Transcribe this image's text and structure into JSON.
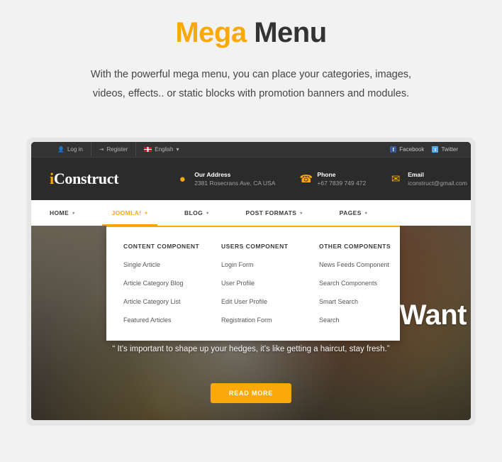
{
  "intro": {
    "title_accent": "Mega",
    "title_rest": " Menu",
    "subtitle_line1": "With the powerful mega menu, you can place your categories, images,",
    "subtitle_line2": "videos, effects.. or static blocks with promotion banners and modules."
  },
  "colors": {
    "accent": "#fba80a",
    "header_dark": "#2b2b2b",
    "topbar_dark": "#333333",
    "title_dark": "#333333"
  },
  "topbar": {
    "login": "Log in",
    "login_icon": "user-icon",
    "register": "Register",
    "register_icon": "sign-in-icon",
    "language": "English",
    "language_icon": "uk-flag-icon",
    "language_caret": "▾",
    "facebook": "Facebook",
    "facebook_icon": "facebook-icon",
    "facebook_glyph": "f",
    "twitter": "Twitter",
    "twitter_icon": "twitter-icon",
    "twitter_glyph": "t"
  },
  "header": {
    "logo_i": "i",
    "logo_rest": "Construct",
    "contacts": [
      {
        "icon": "map-marker-icon",
        "glyph": "⚉",
        "label": "Our Address",
        "value": "2381 Rosecrans Ave, CA USA"
      },
      {
        "icon": "phone-icon",
        "glyph": "☎",
        "label": "Phone",
        "value": "+67 7839 749 472"
      },
      {
        "icon": "envelope-icon",
        "glyph": "✉",
        "label": "Email",
        "value": "iconstruct@gmail.com"
      }
    ]
  },
  "nav": {
    "caret": "▾",
    "items": [
      {
        "label": "HOME",
        "active": false
      },
      {
        "label": "JOOMLA!",
        "active": true
      },
      {
        "label": "BLOG",
        "active": false
      },
      {
        "label": "POST FORMATS",
        "active": false
      },
      {
        "label": "PAGES",
        "active": false
      }
    ]
  },
  "megamenu": {
    "columns": [
      {
        "heading": "CONTENT COMPONENT",
        "links": [
          "Single Article",
          "Article Category Blog",
          "Article Category List",
          "Featured Articles"
        ]
      },
      {
        "heading": "USERS COMPONENT",
        "links": [
          "Login Form",
          "User Profile",
          "Edit User Profile",
          "Registration Form"
        ]
      },
      {
        "heading": "OTHER COMPONENTS",
        "links": [
          "News Feeds Component",
          "Search Components",
          "Smart Search",
          "Search"
        ]
      }
    ]
  },
  "hero": {
    "heading": "n Want",
    "quote": "“ It's important to shape up your hedges, it's like getting a haircut, stay fresh.”",
    "button": "READ MORE"
  }
}
